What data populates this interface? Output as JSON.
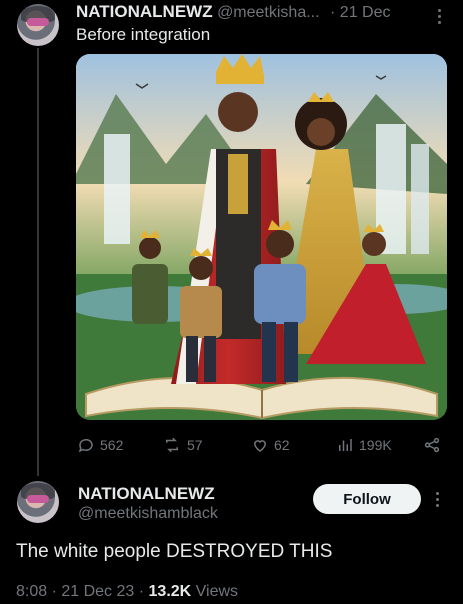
{
  "tweet1": {
    "name": "NATIONALNEWZ",
    "handle": "@meetkisha...",
    "date": "· 21 Dec",
    "text": "Before integration"
  },
  "media": {
    "alt": "Illustrated image of a crowned family standing on an open book in front of waterfalls"
  },
  "actions": {
    "replies": "562",
    "retweets": "57",
    "likes": "62",
    "views": "199K"
  },
  "tweet2": {
    "name": "NATIONALNEWZ",
    "handle": "@meetkishamblack",
    "follow_label": "Follow",
    "text": "The white people DESTROYED THIS",
    "time": "8:08 · 21 Dec 23 · ",
    "views_count": "13.2K",
    "views_label": " Views"
  },
  "colors": {
    "background": "#000000",
    "text": "#e7e9ea",
    "muted": "#71767b",
    "follow_bg": "#eff3f4"
  }
}
